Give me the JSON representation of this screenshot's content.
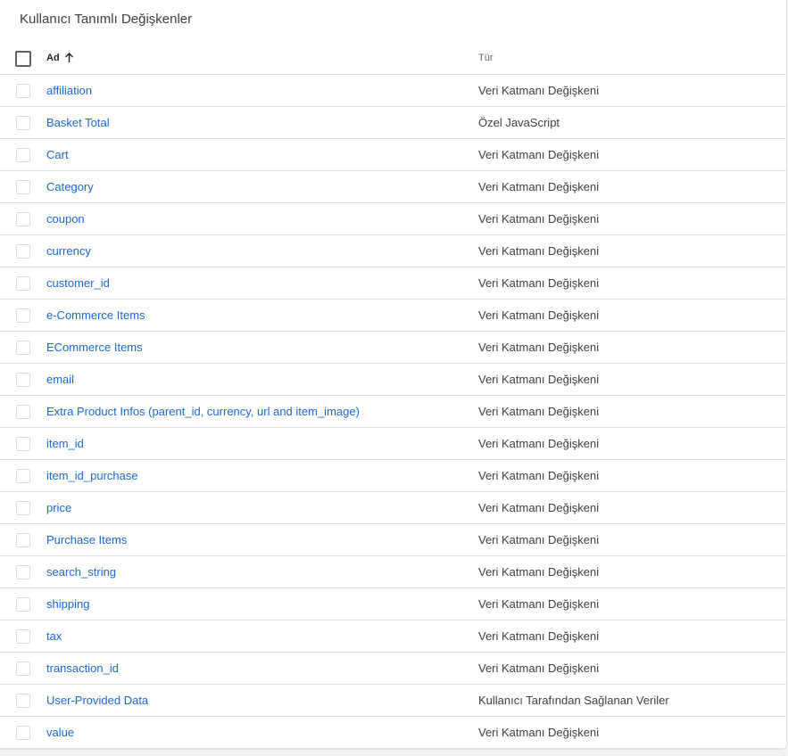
{
  "title": "Kullanıcı Tanımlı Değişkenler",
  "columns": {
    "name": "Ad",
    "type": "Tür"
  },
  "icons": {
    "sort": "arrow-up-icon"
  },
  "rows": [
    {
      "name": "affiliation",
      "type": "Veri Katmanı Değişkeni"
    },
    {
      "name": "Basket Total",
      "type": "Özel JavaScript"
    },
    {
      "name": "Cart",
      "type": "Veri Katmanı Değişkeni"
    },
    {
      "name": "Category",
      "type": "Veri Katmanı Değişkeni"
    },
    {
      "name": "coupon",
      "type": "Veri Katmanı Değişkeni"
    },
    {
      "name": "currency",
      "type": "Veri Katmanı Değişkeni"
    },
    {
      "name": "customer_id",
      "type": "Veri Katmanı Değişkeni"
    },
    {
      "name": "e-Commerce Items",
      "type": "Veri Katmanı Değişkeni"
    },
    {
      "name": "ECommerce Items",
      "type": "Veri Katmanı Değişkeni"
    },
    {
      "name": "email",
      "type": "Veri Katmanı Değişkeni"
    },
    {
      "name": "Extra Product Infos (parent_id, currency, url and item_image)",
      "type": "Veri Katmanı Değişkeni"
    },
    {
      "name": "item_id",
      "type": "Veri Katmanı Değişkeni"
    },
    {
      "name": "item_id_purchase",
      "type": "Veri Katmanı Değişkeni"
    },
    {
      "name": "price",
      "type": "Veri Katmanı Değişkeni"
    },
    {
      "name": "Purchase Items",
      "type": "Veri Katmanı Değişkeni"
    },
    {
      "name": "search_string",
      "type": "Veri Katmanı Değişkeni"
    },
    {
      "name": "shipping",
      "type": "Veri Katmanı Değişkeni"
    },
    {
      "name": "tax",
      "type": "Veri Katmanı Değişkeni"
    },
    {
      "name": "transaction_id",
      "type": "Veri Katmanı Değişkeni"
    },
    {
      "name": "User-Provided Data",
      "type": "Kullanıcı Tarafından Sağlanan Veriler"
    },
    {
      "name": "value",
      "type": "Veri Katmanı Değişkeni"
    }
  ]
}
